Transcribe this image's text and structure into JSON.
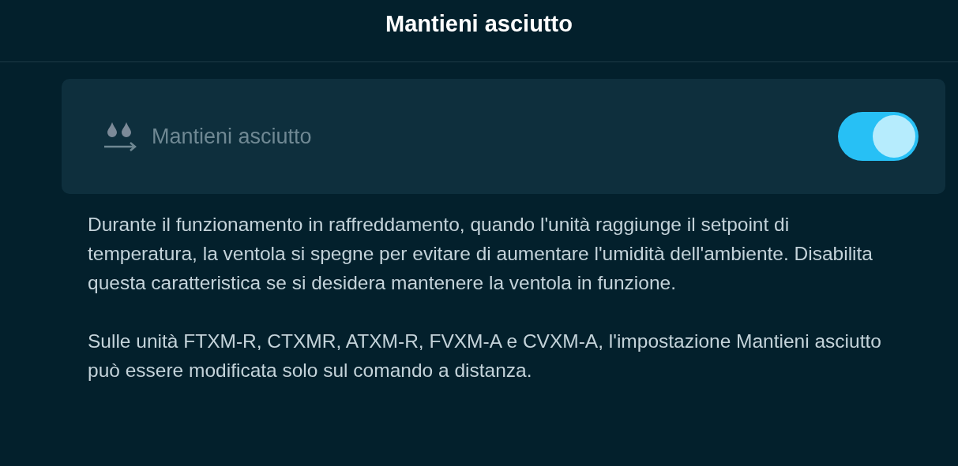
{
  "header": {
    "title": "Mantieni asciutto"
  },
  "setting": {
    "label": "Mantieni asciutto",
    "disabled": true,
    "on": true
  },
  "description": [
    "Durante il funzionamento in raffreddamento, quando l'unità raggiunge il setpoint di temperatura, la ventola si spegne per evitare di aumentare l'umidità dell'ambiente. Disabilita questa caratteristica se si desidera mantenere la ventola in funzione.",
    "Sulle unità FTXM-R, CTXMR, ATXM-R, FVXM-A e CVXM-A, l'impostazione Mantieni asciutto può essere modificata solo sul comando a distanza."
  ]
}
